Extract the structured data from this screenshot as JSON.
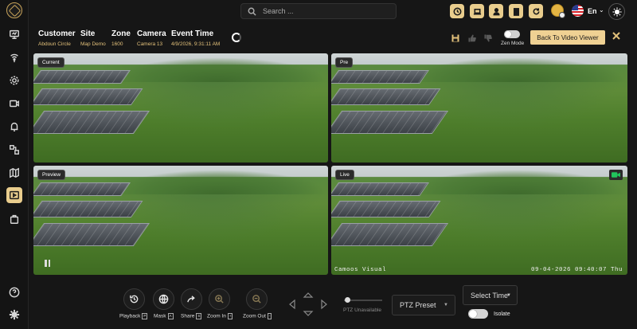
{
  "header": {
    "search_placeholder": "Search ...",
    "language": "En"
  },
  "event": {
    "customer_label": "Customer",
    "customer_value": "Abdoun Circle",
    "site_label": "Site",
    "site_value": "Map Demo",
    "zone_label": "Zone",
    "zone_value": "1600",
    "camera_label": "Camera",
    "camera_value": "Camera 13",
    "time_label": "Event Time",
    "time_value": "4/9/2026, 9:31:11 AM"
  },
  "actions": {
    "zen_mode_label": "Zen Mode",
    "back_label": "Back To Video Viewer"
  },
  "tiles": {
    "current": "Current",
    "pre": "Pre",
    "preview": "Preview",
    "live": "Live",
    "live_osd_left": "Camoos Visual",
    "live_osd_right": "09-04-2026 09:40:07 Thu"
  },
  "controls": {
    "playback": "Playback",
    "playback_key": "P",
    "mask": "Mask",
    "mask_key": "A",
    "share": "Share",
    "share_key": "S",
    "zoom_in": "Zoom In",
    "zoom_in_key": "+",
    "zoom_out": "Zoom Out",
    "zoom_out_key": "-",
    "ptz_status": "PTZ Unavailable",
    "ptz_preset": "PTZ Preset",
    "select_time": "Select Time",
    "isolate": "Isolate"
  },
  "colors": {
    "accent": "#efd193",
    "accent_text": "#e2c07a",
    "background": "#161616",
    "live_indicator": "#21c45c"
  },
  "icons": {
    "sidebar": [
      "dashboard-icon",
      "wireless-icon",
      "settings-icon",
      "camera-icon",
      "alarm-bell-icon",
      "diagram-icon",
      "map-icon",
      "video-player-icon",
      "bag-icon",
      "help-icon",
      "gear-icon"
    ],
    "top": [
      "clock-icon",
      "laptop-icon",
      "user-icon",
      "building-icon",
      "refresh-icon",
      "coin-icon",
      "us-flag-icon",
      "sun-icon"
    ]
  }
}
